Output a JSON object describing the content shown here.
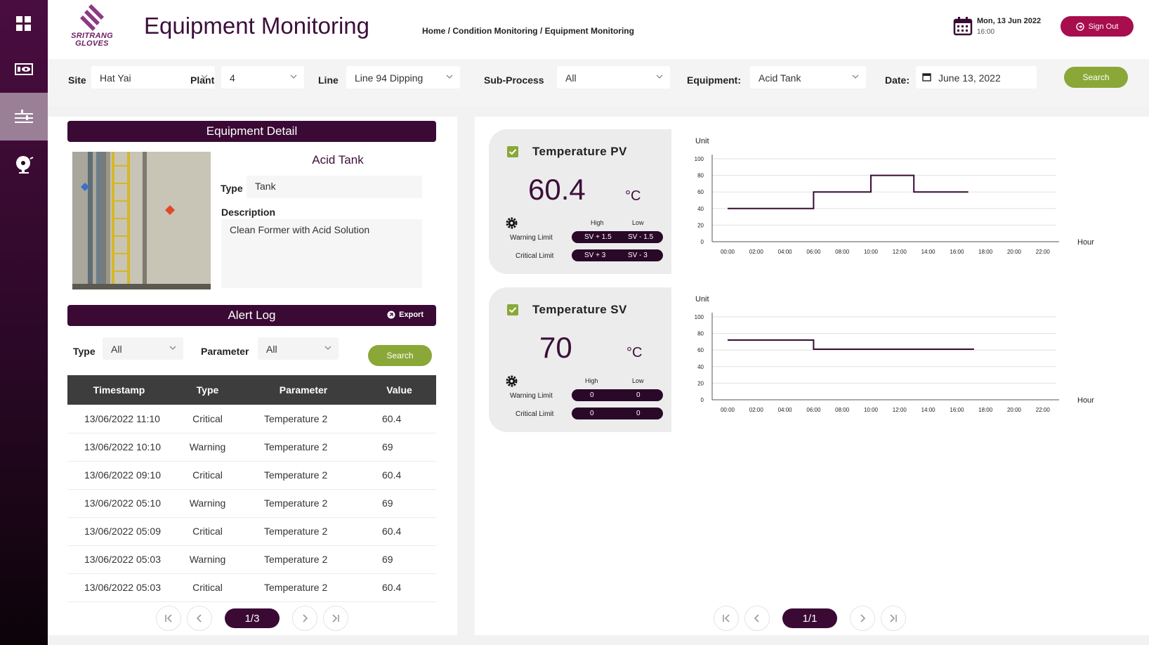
{
  "header": {
    "title": "Equipment Monitoring",
    "breadcrumb": "Home / Condition Monitoring / Equipment Monitoring",
    "date": "Mon, 13 Jun 2022",
    "time": "16:00",
    "signout_label": "Sign Out",
    "logo_line1": "SRITRANG",
    "logo_line2": "GLOVES"
  },
  "filters": {
    "site_label": "Site",
    "site_value": "Hat Yai",
    "plant_label": "Plant",
    "plant_value": "4",
    "line_label": "Line",
    "line_value": "Line 94 Dipping",
    "subprocess_label": "Sub-Process",
    "subprocess_value": "All",
    "equipment_label": "Equipment:",
    "equipment_value": "Acid Tank",
    "date_label": "Date:",
    "date_value": "June 13, 2022",
    "search_label": "Search"
  },
  "equipment": {
    "panel_title": "Equipment Detail",
    "name": "Acid Tank",
    "type_label": "Type",
    "type_value": "Tank",
    "description_label": "Description",
    "description_value": "Clean Former with Acid Solution"
  },
  "alert_log": {
    "title": "Alert Log",
    "export_label": "Export",
    "type_label": "Type",
    "type_value": "All",
    "parameter_label": "Parameter",
    "parameter_value": "All",
    "search_label": "Search",
    "columns": [
      "Timestamp",
      "Type",
      "Parameter",
      "Value"
    ],
    "rows": [
      [
        "13/06/2022 11:10",
        "Critical",
        "Temperature 2",
        "60.4"
      ],
      [
        "13/06/2022 10:10",
        "Warning",
        "Temperature 2",
        "69"
      ],
      [
        "13/06/2022  09:10",
        "Critical",
        "Temperature 2",
        "60.4"
      ],
      [
        "13/06/2022  05:10",
        "Warning",
        "Temperature 2",
        "69"
      ],
      [
        "13/06/2022  05:09",
        "Critical",
        "Temperature 2",
        "60.4"
      ],
      [
        "13/06/2022  05:03",
        "Warning",
        "Temperature 2",
        "69"
      ],
      [
        "13/06/2022  05:03",
        "Critical",
        "Temperature 2",
        "60.4"
      ]
    ],
    "page": "1/3"
  },
  "cards": [
    {
      "title": "Temperature PV",
      "value": "60.4",
      "unit": "°C",
      "high_label": "High",
      "low_label": "Low",
      "warning_label": "Warning Limit",
      "warning_high": "SV + 1.5",
      "warning_low": "SV - 1.5",
      "critical_label": "Critical Limit",
      "critical_high": "SV + 3",
      "critical_low": "SV - 3"
    },
    {
      "title": "Temperature SV",
      "value": "70",
      "unit": "°C",
      "high_label": "High",
      "low_label": "Low",
      "warning_label": "Warning Limit",
      "warning_high": "0",
      "warning_low": "0",
      "critical_label": "Critical Limit",
      "critical_high": "0",
      "critical_low": "0"
    }
  ],
  "chart_data": [
    {
      "type": "line",
      "step": true,
      "ylabel": "Unit",
      "xlabel": "Hour",
      "ylim": [
        0,
        100
      ],
      "yticks": [
        0,
        20,
        40,
        60,
        80,
        100
      ],
      "xticks": [
        "00:00",
        "02:00",
        "04:00",
        "06:00",
        "08:00",
        "10:00",
        "12:00",
        "14:00",
        "16:00",
        "18:00",
        "20:00",
        "22:00"
      ],
      "grid": true,
      "line_color": "#3a0a35",
      "points": [
        [
          0,
          40
        ],
        [
          6,
          40
        ],
        [
          6,
          60
        ],
        [
          10,
          60
        ],
        [
          10,
          80
        ],
        [
          13,
          80
        ],
        [
          13,
          60
        ],
        [
          16.8,
          60
        ]
      ]
    },
    {
      "type": "line",
      "step": true,
      "ylabel": "Unit",
      "xlabel": "Hour",
      "ylim": [
        0,
        100
      ],
      "yticks": [
        0,
        20,
        40,
        60,
        80,
        100
      ],
      "xticks": [
        "00:00",
        "02:00",
        "04:00",
        "06:00",
        "08:00",
        "10:00",
        "12:00",
        "14:00",
        "16:00",
        "18:00",
        "20:00",
        "22:00"
      ],
      "grid": true,
      "line_color": "#3a0a35",
      "points": [
        [
          0,
          72
        ],
        [
          6,
          72
        ],
        [
          6,
          61
        ],
        [
          17.2,
          61
        ]
      ]
    }
  ],
  "chart_page": "1/1",
  "colors": {
    "brand": "#3a0a35",
    "accent": "#8aa838",
    "signout": "#a80d4d"
  }
}
